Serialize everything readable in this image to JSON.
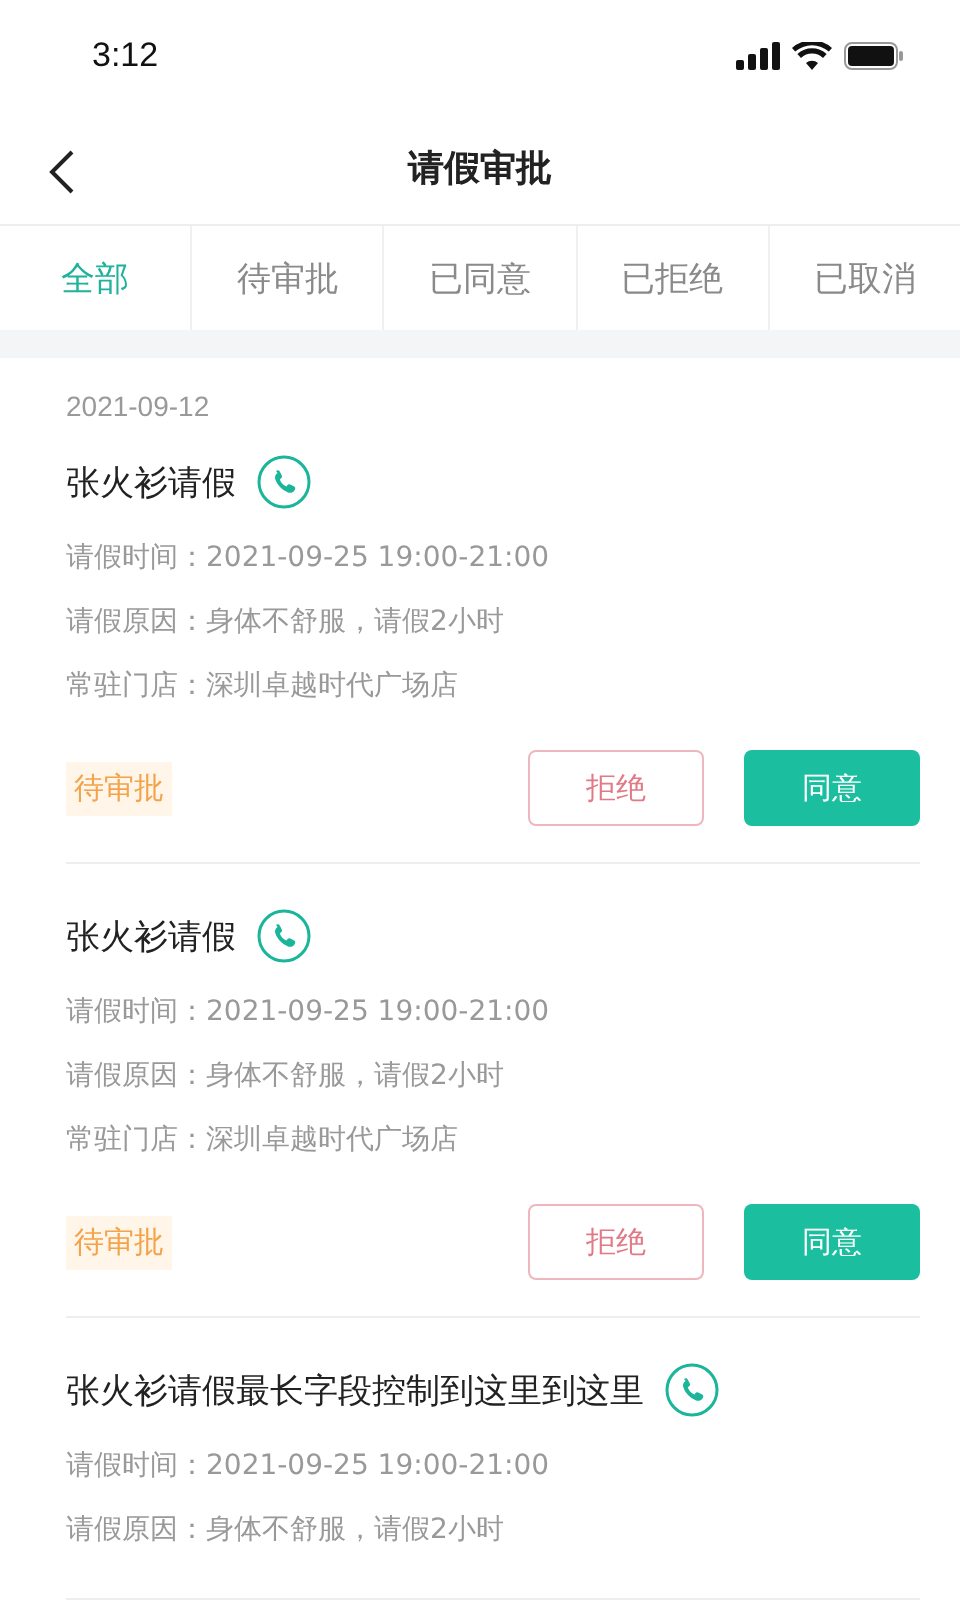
{
  "status_bar": {
    "time": "3:12"
  },
  "header": {
    "title": "请假审批"
  },
  "tabs": [
    {
      "label": "全部",
      "selected": true
    },
    {
      "label": "待审批",
      "selected": false
    },
    {
      "label": "已同意",
      "selected": false
    },
    {
      "label": "已拒绝",
      "selected": false
    },
    {
      "label": "已取消",
      "selected": false
    }
  ],
  "requests": [
    {
      "date": "2021-09-12",
      "title": "张火衫请假",
      "details": [
        "请假时间：2021-09-25 19:00-21:00",
        "请假原因：身体不舒服，请假2小时",
        "常驻门店：深圳卓越时代广场店"
      ],
      "status": "待审批",
      "actions": [
        {
          "label": "拒绝",
          "kind": "reject"
        },
        {
          "label": "同意",
          "kind": "approve"
        }
      ]
    },
    {
      "title": "张火衫请假",
      "details": [
        "请假时间：2021-09-25 19:00-21:00",
        "请假原因：身体不舒服，请假2小时",
        "常驻门店：深圳卓越时代广场店"
      ],
      "status": "待审批",
      "actions": [
        {
          "label": "拒绝",
          "kind": "reject"
        },
        {
          "label": "同意",
          "kind": "approve"
        }
      ]
    },
    {
      "title": "张火衫请假最长字段控制到这里到这里",
      "details": [
        "请假时间：2021-09-25 19:00-21:00",
        "请假原因：身体不舒服，请假2小时"
      ]
    }
  ]
}
